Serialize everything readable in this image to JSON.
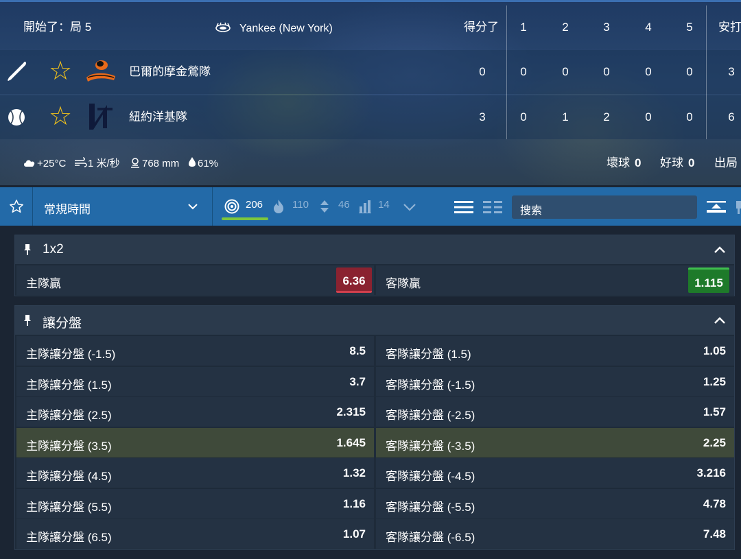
{
  "scoreboard": {
    "status": "開始了：局 5",
    "venue": "Yankee (New York)",
    "headers": {
      "score": "得分了",
      "i1": "1",
      "i2": "2",
      "i3": "3",
      "i4": "4",
      "i5": "5",
      "hits": "安打"
    },
    "teams": [
      {
        "name": "巴爾的摩金鶯隊",
        "logo_text": "Orioles",
        "score": "0",
        "innings": [
          "0",
          "0",
          "0",
          "0",
          "0"
        ],
        "hits": "3"
      },
      {
        "name": "紐約洋基隊",
        "logo_text": "NY",
        "score": "3",
        "innings": [
          "0",
          "1",
          "2",
          "0",
          "0"
        ],
        "hits": "6"
      }
    ],
    "weather": {
      "temp": "+25°C",
      "wind": "1 米/秒",
      "pressure": "768 mm",
      "humidity": "61%"
    },
    "count": {
      "balls_label": "壞球",
      "balls": "0",
      "strikes_label": "好球",
      "strikes": "0",
      "outs_label": "出局"
    }
  },
  "toolbar": {
    "period": "常規時間",
    "counts": {
      "all": "206",
      "popular": "110",
      "handicap": "46",
      "stats": "14"
    },
    "search_placeholder": "搜索"
  },
  "markets": [
    {
      "title": "1x2",
      "rows": [
        {
          "left_label": "主隊贏",
          "left_odd": "6.36",
          "right_label": "客隊贏",
          "right_odd": "1.115"
        }
      ]
    },
    {
      "title": "讓分盤",
      "rows": [
        {
          "left_label": "主隊讓分盤 (-1.5)",
          "left_odd": "8.5",
          "right_label": "客隊讓分盤 (1.5)",
          "right_odd": "1.05"
        },
        {
          "left_label": "主隊讓分盤 (1.5)",
          "left_odd": "3.7",
          "right_label": "客隊讓分盤 (-1.5)",
          "right_odd": "1.25"
        },
        {
          "left_label": "主隊讓分盤 (2.5)",
          "left_odd": "2.315",
          "right_label": "客隊讓分盤 (-2.5)",
          "right_odd": "1.57"
        },
        {
          "left_label": "主隊讓分盤 (3.5)",
          "left_odd": "1.645",
          "right_label": "客隊讓分盤 (-3.5)",
          "right_odd": "2.25"
        },
        {
          "left_label": "主隊讓分盤 (4.5)",
          "left_odd": "1.32",
          "right_label": "客隊讓分盤 (-4.5)",
          "right_odd": "3.216"
        },
        {
          "left_label": "主隊讓分盤 (5.5)",
          "left_odd": "1.16",
          "right_label": "客隊讓分盤 (-5.5)",
          "right_odd": "4.78"
        },
        {
          "left_label": "主隊讓分盤 (6.5)",
          "left_odd": "1.07",
          "right_label": "客隊讓分盤 (-6.5)",
          "right_odd": "7.48"
        }
      ]
    }
  ],
  "colors": {
    "odd_down": "#8a2230",
    "odd_up": "#1e7a2a",
    "accent": "#236aa8",
    "star": "#f2c21b"
  }
}
